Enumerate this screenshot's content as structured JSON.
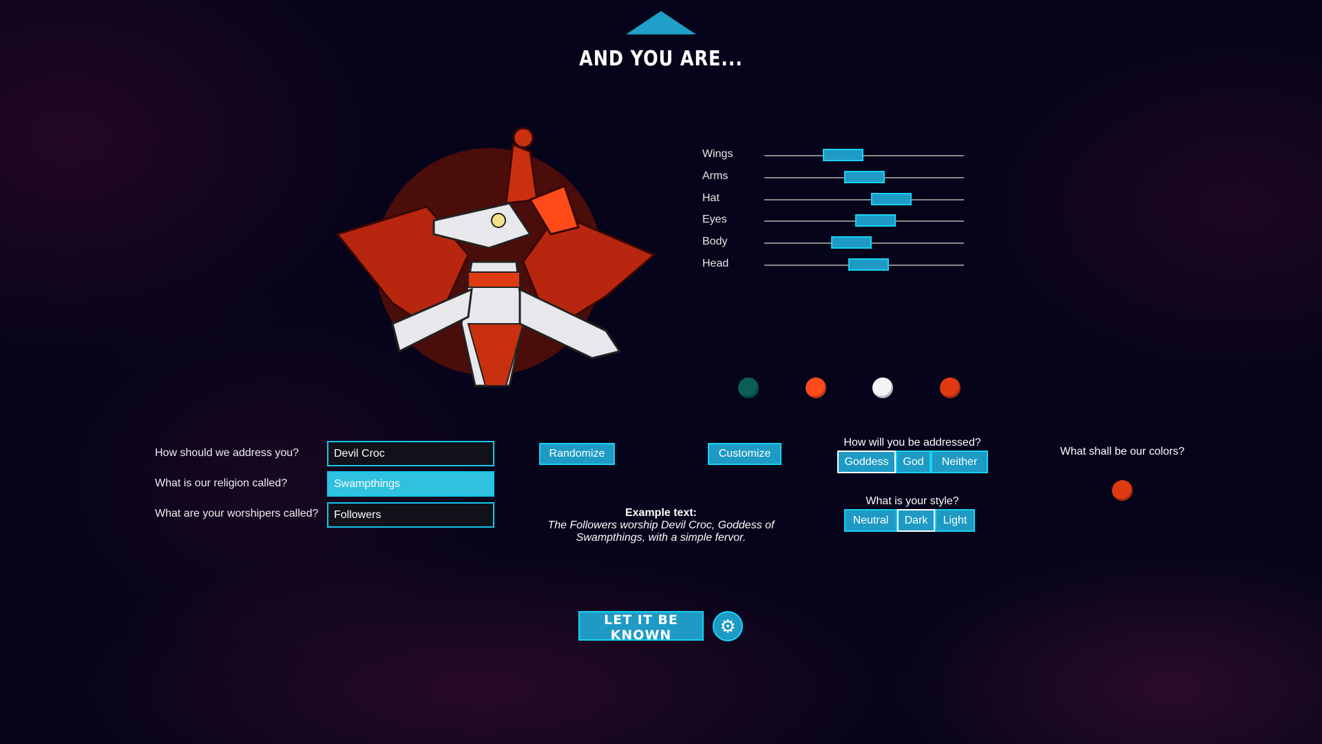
{
  "title": "AND YOU ARE...",
  "sliders": [
    {
      "label": "Wings",
      "value": 0.37
    },
    {
      "label": "Arms",
      "value": 0.5
    },
    {
      "label": "Hat",
      "value": 0.67
    },
    {
      "label": "Eyes",
      "value": 0.57
    },
    {
      "label": "Body",
      "value": 0.42
    },
    {
      "label": "Head",
      "value": 0.53
    }
  ],
  "palette": [
    "#0b5e58",
    "#ff4a1a",
    "#f2f4f6",
    "#e03a12"
  ],
  "form": {
    "name_label": "How should we address you?",
    "name_value": "Devil Croc",
    "religion_label": "What is our religion called?",
    "religion_value": "Swampthings",
    "worshipers_label": "What are your worshipers called?",
    "worshipers_value": "Followers"
  },
  "randomize_label": "Randomize",
  "customize_label": "Customize",
  "example": {
    "heading": "Example text:",
    "line1": "The Followers worship Devil Croc, Goddess of",
    "line2": "Swampthings, with a simple fervor."
  },
  "address": {
    "label": "How will you be addressed?",
    "options": [
      "Goddess",
      "God",
      "Neither"
    ],
    "selected": "Goddess"
  },
  "style": {
    "label": "What is your style?",
    "options": [
      "Neutral",
      "Dark",
      "Light"
    ],
    "selected": "Dark"
  },
  "colors": {
    "label": "What shall be our colors?",
    "swatch": "#e03a12"
  },
  "confirm_label": "LET IT BE KNOWN",
  "settings_icon": "gear-icon",
  "accent": "#1e9ac4"
}
